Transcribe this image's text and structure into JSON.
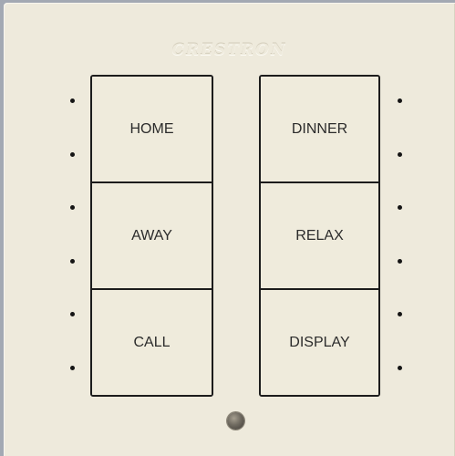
{
  "brand": {
    "logo_text": "CRESTRON"
  },
  "keypad": {
    "left_buttons": [
      {
        "label": "HOME"
      },
      {
        "label": "AWAY"
      },
      {
        "label": "CALL"
      }
    ],
    "right_buttons": [
      {
        "label": "DINNER"
      },
      {
        "label": "RELAX"
      },
      {
        "label": "DISPLAY"
      }
    ]
  },
  "colors": {
    "faceplate": "#eeeadc",
    "background": "#a3a9b3",
    "button_border": "#1c1c1c",
    "indicator_led": "#151515"
  },
  "icons": {
    "indicator": "led-dot-icon",
    "sensor": "ambient-light-sensor-icon"
  }
}
